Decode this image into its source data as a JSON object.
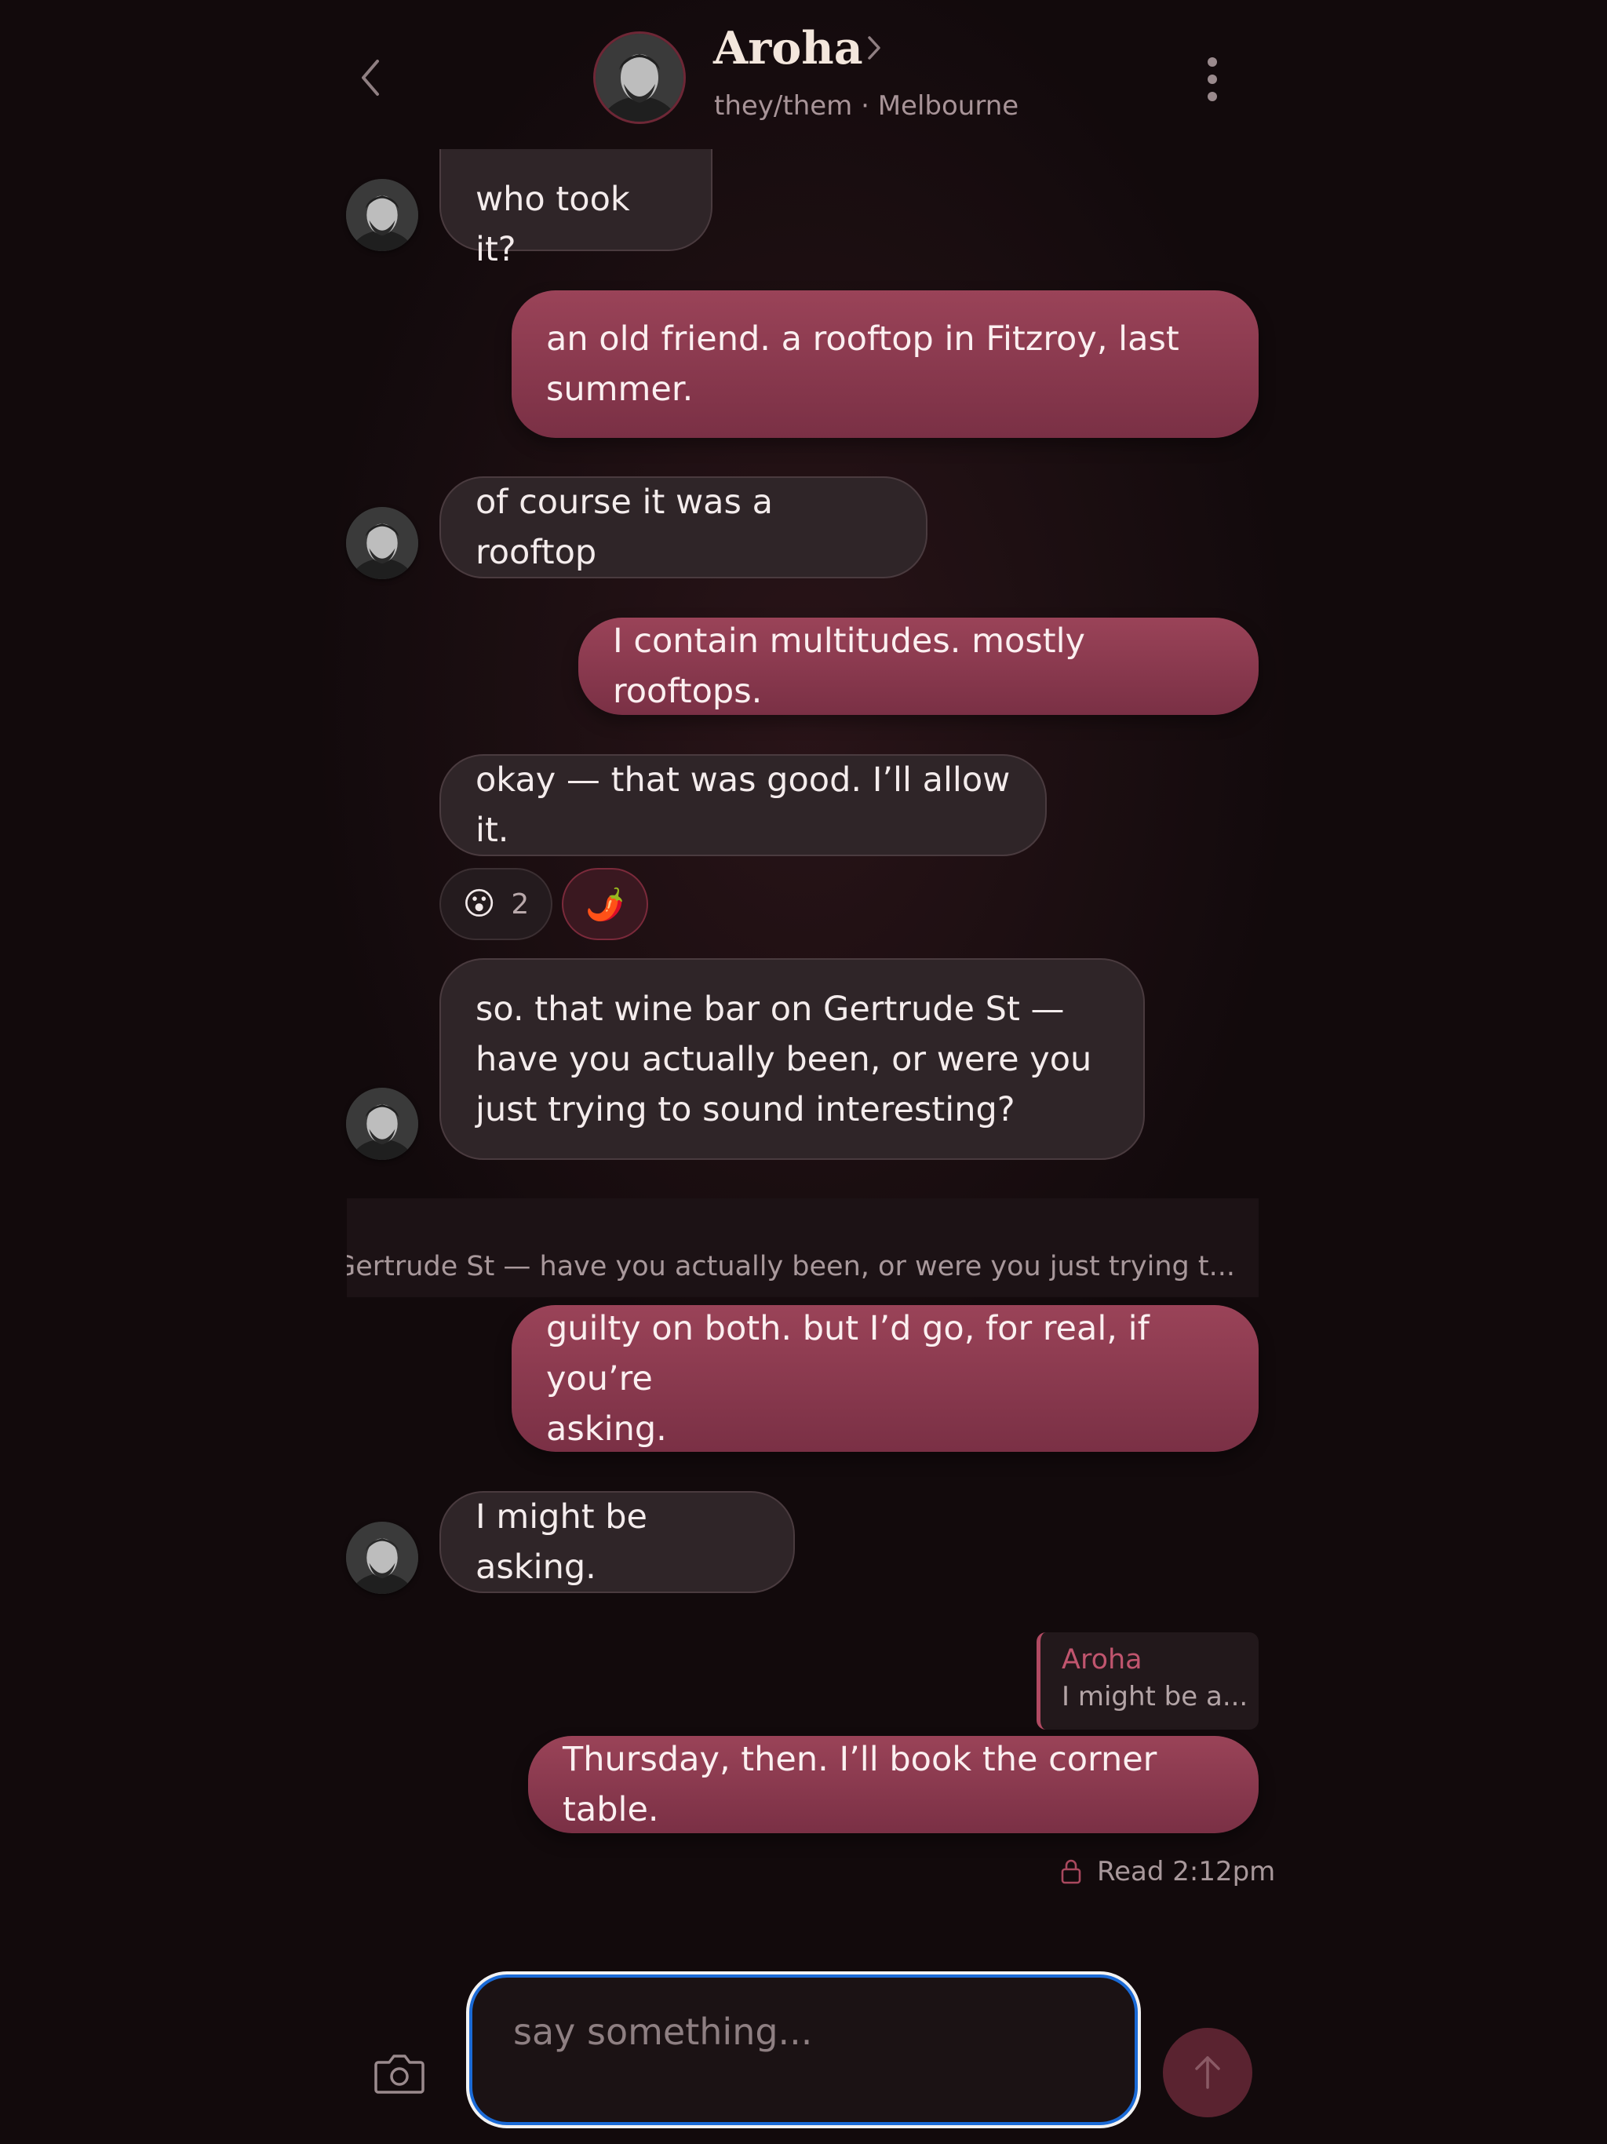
{
  "header": {
    "back_icon": "chevron-left-icon",
    "contact_name": "Aroha",
    "contact_subtitle": "they/them · Melbourne",
    "name_chevron_icon": "chevron-right-icon",
    "more_icon": "more-vertical-icon"
  },
  "messages": [
    {
      "direction": "in",
      "text": "who took it?"
    },
    {
      "direction": "out",
      "lines": [
        "an old friend. a rooftop in Fitzroy, last",
        "summer."
      ]
    },
    {
      "direction": "in",
      "text": "of course it was a rooftop"
    },
    {
      "direction": "out",
      "text": "I contain multitudes. mostly rooftops."
    },
    {
      "direction": "in",
      "text": "okay — that was good. I’ll allow it."
    },
    {
      "direction": "in",
      "lines": [
        "so. that wine bar on Gertrude St —",
        "have you actually been, or were you",
        "just trying to sound interesting?"
      ]
    },
    {
      "direction": "out",
      "lines": [
        "guilty on both. but I’d go, for real, if you’re",
        "asking."
      ]
    },
    {
      "direction": "in",
      "text": "I might be asking."
    },
    {
      "direction": "out",
      "text": "Thursday, then. I’ll book the corner table."
    }
  ],
  "reactions": [
    {
      "emoji": "😮",
      "count": "2"
    },
    {
      "emoji": "🌶️"
    }
  ],
  "quoted_strip": {
    "text": "ar on Gertrude St — have you actually been, or were you just trying t..."
  },
  "reply_preview": {
    "author": "Aroha",
    "text": "I might be a..."
  },
  "read_status": {
    "icon": "lock-icon",
    "text": "Read 2:12pm"
  },
  "composer": {
    "placeholder": "say something...",
    "value": "",
    "camera_icon": "camera-icon",
    "send_icon": "arrow-up-icon"
  },
  "colors": {
    "background": "#120a0c",
    "incoming_bubble": "#2f2528",
    "outgoing_bubble": "#8a3a4f",
    "accent": "#b04a62",
    "focus_ring": "#1a6ad6"
  }
}
